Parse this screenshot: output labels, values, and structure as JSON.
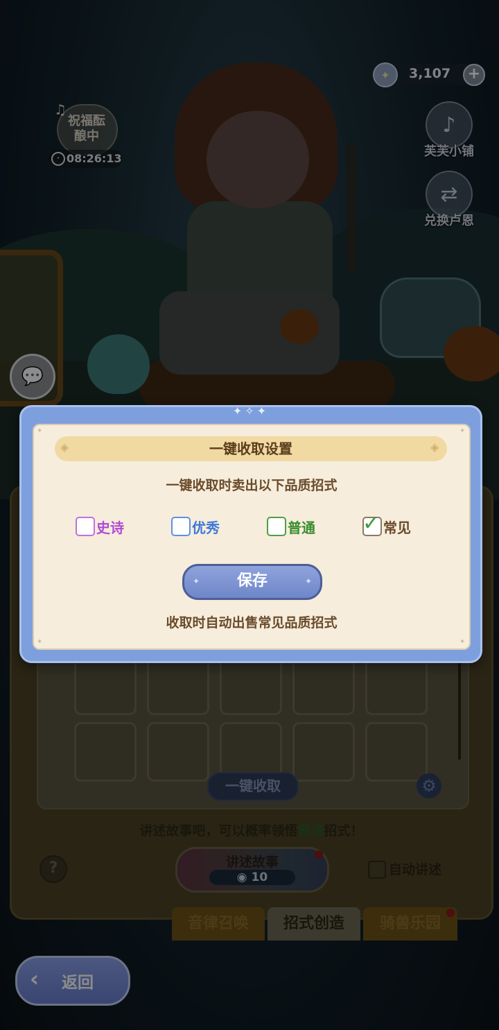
{
  "hud": {
    "currency_amount": "3,107",
    "currency_plus": "+",
    "bless_label": "祝福酝酿中",
    "timer": "08:26:13",
    "shop_label": "芙芙小铺",
    "exchange_label": "兑换卢恩"
  },
  "workshop": {
    "collect_label": "一键收取",
    "story_hint_prefix": "讲述故事吧，可以概率领悟",
    "story_hint_highlight": "普通",
    "story_hint_suffix": "招式！",
    "help_label": "?",
    "story_button_label": "讲述故事",
    "story_cost": "10",
    "auto_label": "自动讲述"
  },
  "tabs": [
    {
      "label": "音律召唤",
      "active": false
    },
    {
      "label": "招式创造",
      "active": true
    },
    {
      "label": "骑兽乐园",
      "active": false
    }
  ],
  "back_label": "返回",
  "dialog": {
    "title": "一键收取设置",
    "subtitle": "一键收取时卖出以下品质招式",
    "options": [
      {
        "label": "史诗",
        "checked": false,
        "color": "#b24ad6"
      },
      {
        "label": "优秀",
        "checked": false,
        "color": "#3f78d8"
      },
      {
        "label": "普通",
        "checked": false,
        "color": "#3a8d2e"
      },
      {
        "label": "常见",
        "checked": true,
        "color": "#6a4a2a"
      }
    ],
    "save_label": "保存",
    "note": "收取时自动出售常见品质招式"
  }
}
